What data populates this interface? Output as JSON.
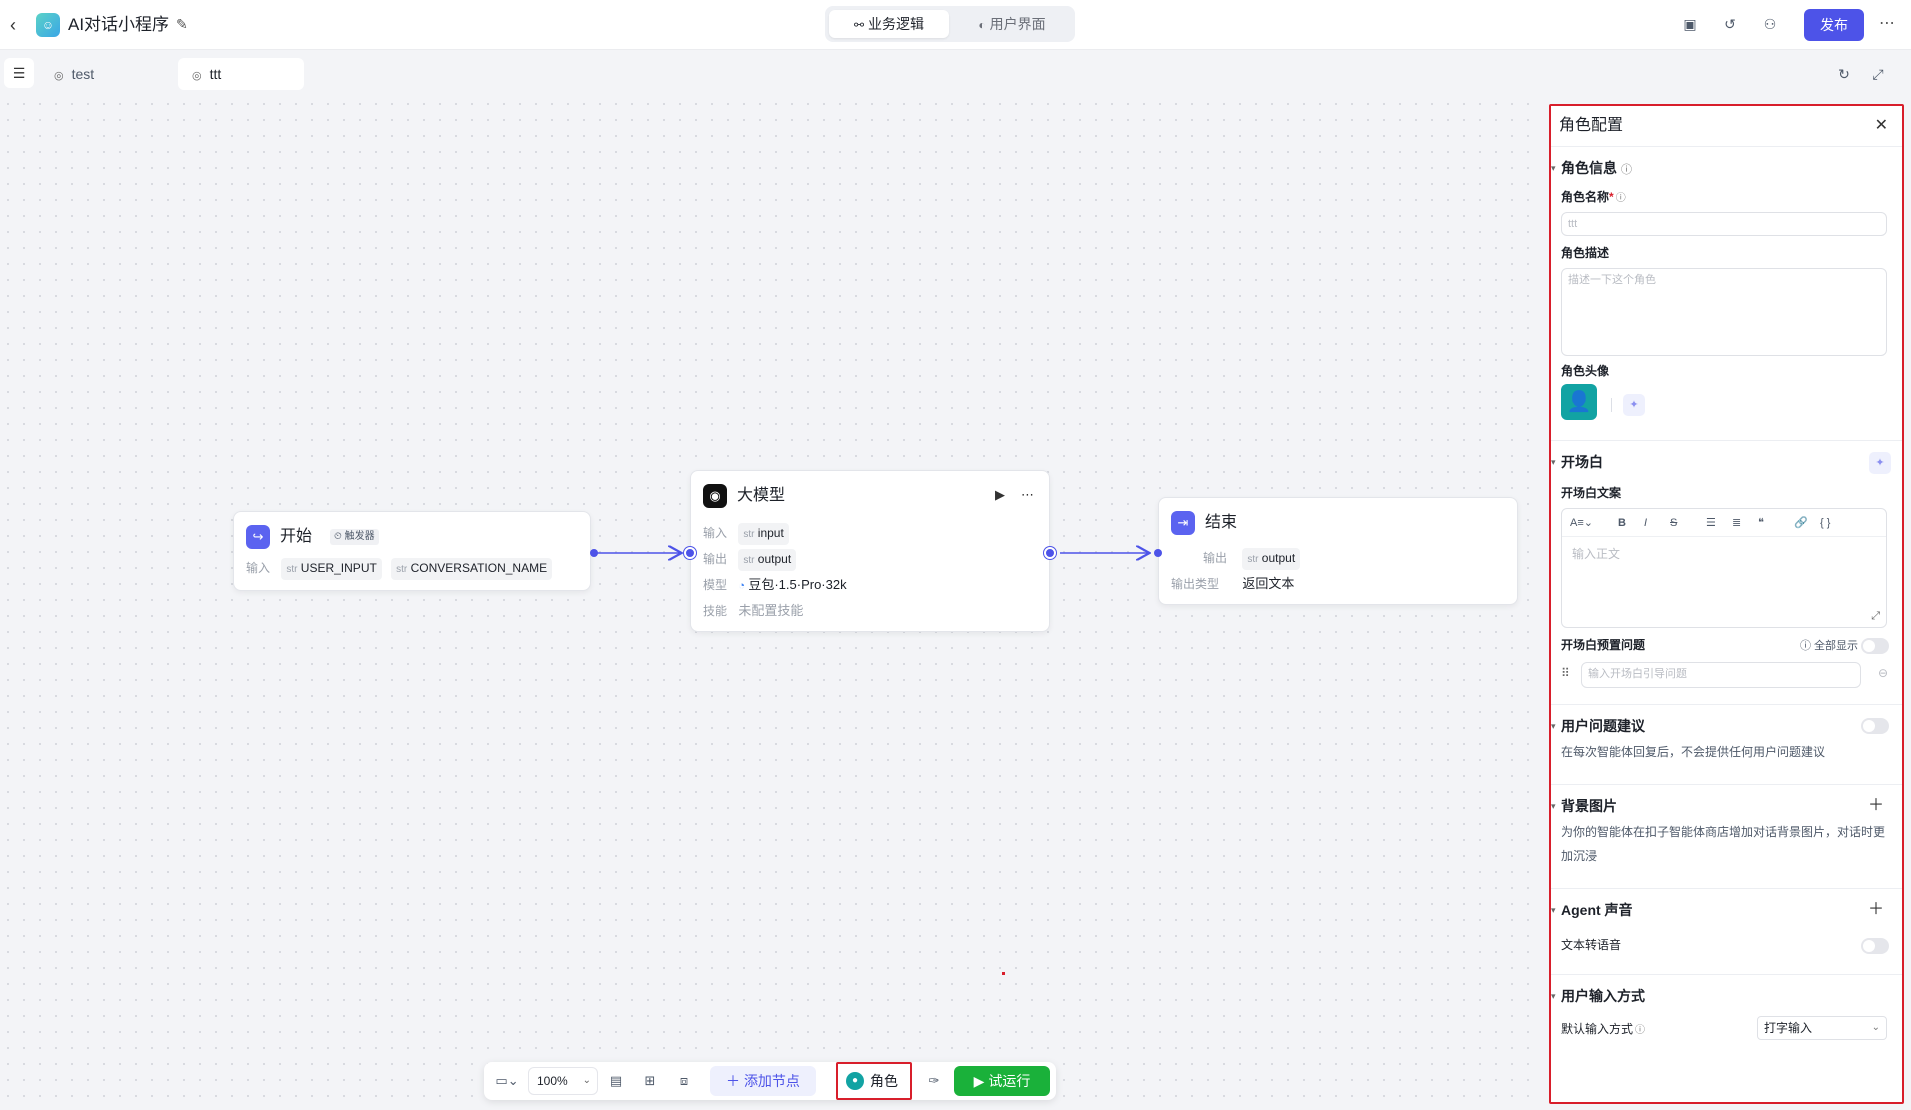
{
  "app": {
    "title": "AI对话小程序",
    "logo": "bot-icon"
  },
  "header": {
    "tabs": [
      {
        "label": "业务逻辑",
        "icon": "flow-icon",
        "active": true
      },
      {
        "label": "用户界面",
        "icon": "palette-icon",
        "active": false
      }
    ],
    "publish_label": "发布"
  },
  "subtabs": [
    {
      "label": "test"
    },
    {
      "label": "ttt",
      "active": true
    }
  ],
  "nodes": {
    "start": {
      "title": "开始",
      "badge": "触发器",
      "input_label": "输入",
      "inputs": [
        {
          "type": "str",
          "name": "USER_INPUT"
        },
        {
          "type": "str",
          "name": "CONVERSATION_NAME"
        }
      ]
    },
    "llm": {
      "title": "大模型",
      "input_label": "输入",
      "input": {
        "type": "str",
        "name": "input"
      },
      "output_label": "输出",
      "output": {
        "type": "str",
        "name": "output"
      },
      "model_label": "模型",
      "model": "豆包·1.5·Pro·32k",
      "skill_label": "技能",
      "skill": "未配置技能"
    },
    "end": {
      "title": "结束",
      "output_label": "输出",
      "output": {
        "type": "str",
        "name": "output"
      },
      "output_type_label": "输出类型",
      "output_type": "返回文本"
    }
  },
  "toolbar": {
    "zoom": "100%",
    "add_node": "添加节点",
    "role": "角色",
    "run": "试运行"
  },
  "panel": {
    "title": "角色配置",
    "role_info": "角色信息",
    "name_label": "角色名称",
    "name_placeholder": "ttt",
    "desc_label": "角色描述",
    "desc_placeholder": "描述一下这个角色",
    "avatar_label": "角色头像",
    "opening": "开场白",
    "opening_text_label": "开场白文案",
    "opening_placeholder": "输入正文",
    "preset_label": "开场白预置问题",
    "show_all": "全部显示",
    "preset_placeholder": "输入开场白引导问题",
    "suggest": "用户问题建议",
    "suggest_desc": "在每次智能体回复后，不会提供任何用户问题建议",
    "bg": "背景图片",
    "bg_desc": "为你的智能体在扣子智能体商店增加对话背景图片，对话时更加沉浸",
    "voice": "Agent 声音",
    "tts": "文本转语音",
    "input_mode": "用户输入方式",
    "default_input_label": "默认输入方式",
    "default_input_value": "打字输入"
  }
}
